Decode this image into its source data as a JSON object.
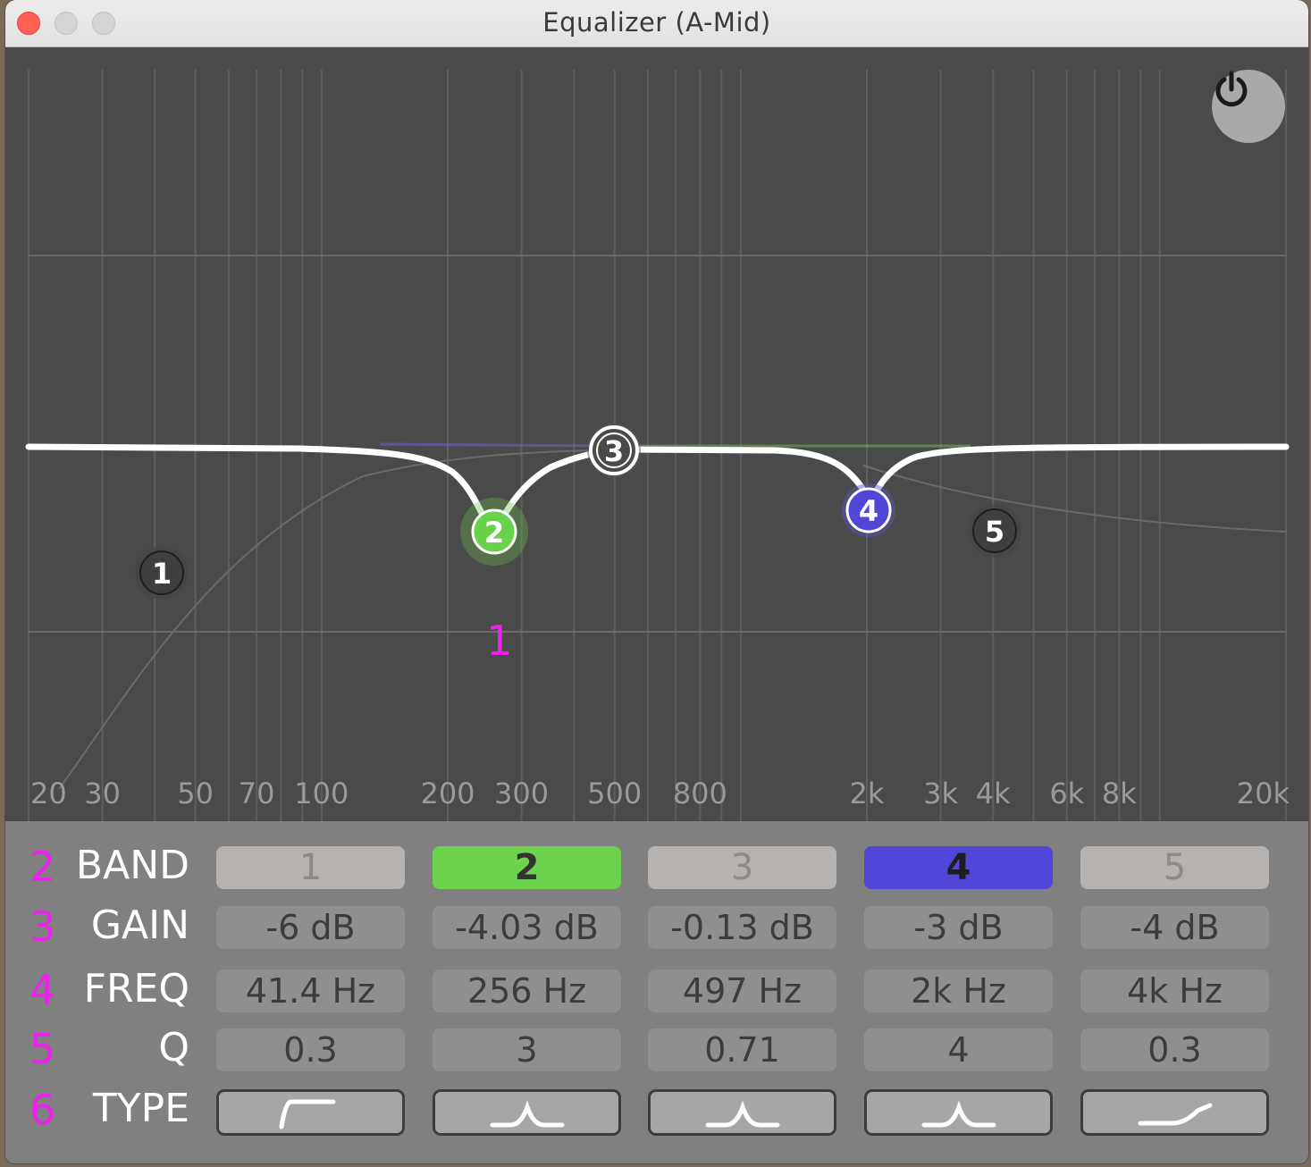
{
  "window": {
    "title": "Equalizer (A-Mid)"
  },
  "graph": {
    "freq_labels": [
      "20",
      "30",
      "50",
      "70",
      "100",
      "200",
      "300",
      "500",
      "800",
      "2k",
      "3k",
      "4k",
      "6k",
      "8k",
      "20k"
    ],
    "annotation": "1",
    "nodes": [
      {
        "label": "1",
        "color": "#3f3f3f"
      },
      {
        "label": "2",
        "color": "#69d24b"
      },
      {
        "label": "3",
        "color": "#ffffff"
      },
      {
        "label": "4",
        "color": "#5146d8"
      },
      {
        "label": "5",
        "color": "#3f3f3f"
      }
    ]
  },
  "panel": {
    "row_numbers": [
      "2",
      "3",
      "4",
      "5",
      "6"
    ],
    "row_labels": [
      "BAND",
      "GAIN",
      "FREQ",
      "Q",
      "TYPE"
    ],
    "bands": [
      {
        "label": "1",
        "gain": "-6 dB",
        "freq": "41.4 Hz",
        "q": "0.3",
        "type": "high-pass-icon",
        "color": "#b6b2b0",
        "active": false
      },
      {
        "label": "2",
        "gain": "-4.03 dB",
        "freq": "256 Hz",
        "q": "3",
        "type": "bell-icon",
        "color": "#6dd24d",
        "active": true
      },
      {
        "label": "3",
        "gain": "-0.13 dB",
        "freq": "497 Hz",
        "q": "0.71",
        "type": "bell-icon",
        "color": "#b6b2b0",
        "active": false
      },
      {
        "label": "4",
        "gain": "-3 dB",
        "freq": "2k Hz",
        "q": "4",
        "type": "bell-icon",
        "color": "#5146d8",
        "active": true
      },
      {
        "label": "5",
        "gain": "-4 dB",
        "freq": "4k Hz",
        "q": "0.3",
        "type": "high-shelf-icon",
        "color": "#b6b2b0",
        "active": false
      }
    ]
  },
  "colors": {
    "accent_magenta": "#ee22ee",
    "graph_bg": "#4a4a4a",
    "panel_bg": "#808080"
  }
}
